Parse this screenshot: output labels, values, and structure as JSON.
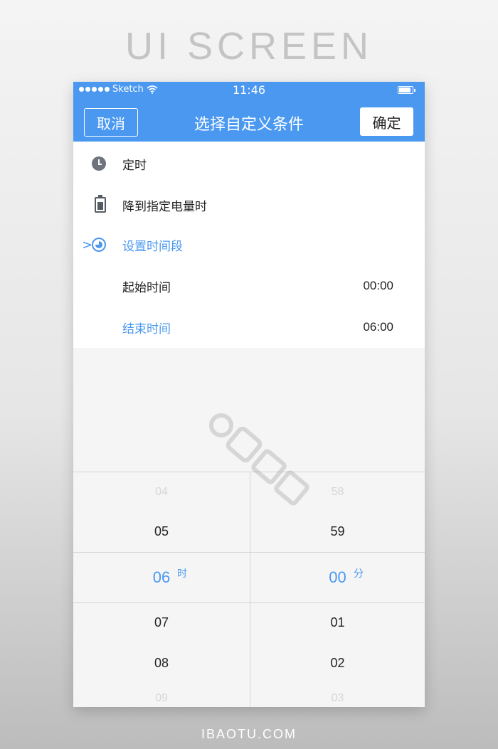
{
  "banner": {
    "title": "UI SCREEN",
    "footer": "IBAOTU.COM"
  },
  "status_bar": {
    "carrier": "Sketch",
    "time": "11:46"
  },
  "nav": {
    "cancel": "取消",
    "title": "选择自定义条件",
    "confirm": "确定"
  },
  "conditions": [
    {
      "label": "定时",
      "icon": "clock-icon"
    },
    {
      "label": "降到指定电量时",
      "icon": "battery-icon"
    },
    {
      "label": "设置时间段",
      "icon": "timer-icon",
      "active": true,
      "caret": ">"
    }
  ],
  "time_range": {
    "start_label": "起始时间",
    "start_value": "00:00",
    "end_label": "结束时间",
    "end_value": "06:00"
  },
  "picker": {
    "hours": [
      "04",
      "05",
      "06",
      "07",
      "08",
      "09"
    ],
    "hour_unit": "时",
    "minutes": [
      "58",
      "59",
      "00",
      "01",
      "02",
      "03"
    ],
    "minute_unit": "分",
    "selected_index": 2
  },
  "colors": {
    "accent": "#4a98f0",
    "background": "#f5f5f5"
  }
}
